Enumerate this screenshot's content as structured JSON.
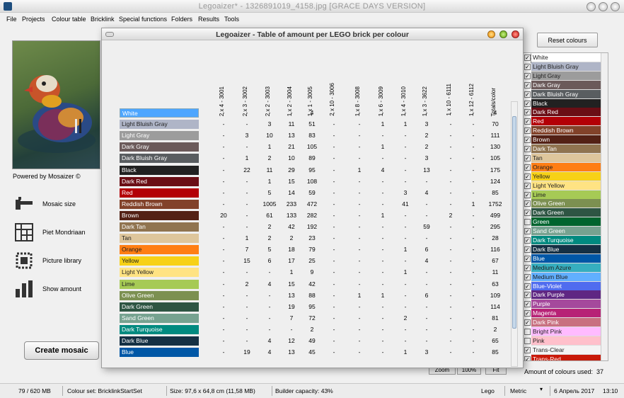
{
  "window": {
    "title": "Legoaizer* - 1326891019_4158.jpg      [GRACE DAYS VERSION]"
  },
  "menu": [
    "File",
    "Projects",
    "Colour table",
    "Bricklink",
    "Special functions",
    "Folders",
    "Results",
    "Tools"
  ],
  "left_panel": {
    "powered": "Powered by Mosaizer ©",
    "tools": [
      "Mosaic size",
      "Piet Mondriaan",
      "Picture library",
      "Show amount"
    ],
    "create_button": "Create mosaic"
  },
  "right_panel": {
    "reset_button": "Reset colours",
    "colours_used_label": "Amount of colours used:",
    "colours_used_value": "37",
    "colours": [
      {
        "name": "White",
        "hex": "#ffffff",
        "checked": true,
        "selected": true
      },
      {
        "name": "Light Bluish Gray",
        "hex": "#afb5c7",
        "checked": true
      },
      {
        "name": "Light Gray",
        "hex": "#9c9c9c",
        "checked": true
      },
      {
        "name": "Dark Gray",
        "hex": "#6b5a5a",
        "checked": true
      },
      {
        "name": "Dark Bluish Gray",
        "hex": "#595d60",
        "checked": true
      },
      {
        "name": "Black",
        "hex": "#212121",
        "checked": true
      },
      {
        "name": "Dark Red",
        "hex": "#6a0e15",
        "checked": true
      },
      {
        "name": "Red",
        "hex": "#b30006",
        "checked": true
      },
      {
        "name": "Reddish Brown",
        "hex": "#82422a",
        "checked": true
      },
      {
        "name": "Brown",
        "hex": "#532115",
        "checked": true
      },
      {
        "name": "Dark Tan",
        "hex": "#907450",
        "checked": true
      },
      {
        "name": "Tan",
        "hex": "#dec69c",
        "checked": true
      },
      {
        "name": "Orange",
        "hex": "#ff7e14",
        "checked": true
      },
      {
        "name": "Yellow",
        "hex": "#f7d117",
        "checked": true
      },
      {
        "name": "Light Yellow",
        "hex": "#ffe383",
        "checked": true
      },
      {
        "name": "Lime",
        "hex": "#a6ca55",
        "checked": true
      },
      {
        "name": "Olive Green",
        "hex": "#7c9051",
        "checked": true
      },
      {
        "name": "Dark Green",
        "hex": "#2e5543",
        "checked": true
      },
      {
        "name": "Green",
        "hex": "#00642e",
        "checked": false
      },
      {
        "name": "Sand Green",
        "hex": "#76a290",
        "checked": true
      },
      {
        "name": "Dark Turquoise",
        "hex": "#008a80",
        "checked": true
      },
      {
        "name": "Dark Blue",
        "hex": "#143044",
        "checked": true
      },
      {
        "name": "Blue",
        "hex": "#0057a6",
        "checked": true
      },
      {
        "name": "Medium Azure",
        "hex": "#36aebf",
        "checked": true
      },
      {
        "name": "Medium Blue",
        "hex": "#61afff",
        "checked": true
      },
      {
        "name": "Blue-Violet",
        "hex": "#506cef",
        "checked": true
      },
      {
        "name": "Dark Purple",
        "hex": "#5f2683",
        "checked": true
      },
      {
        "name": "Purple",
        "hex": "#a5499c",
        "checked": true
      },
      {
        "name": "Magenta",
        "hex": "#b72276",
        "checked": true
      },
      {
        "name": "Dark Pink",
        "hex": "#c87080",
        "checked": true
      },
      {
        "name": "Bright Pink",
        "hex": "#ffbbff",
        "checked": false
      },
      {
        "name": "Pink",
        "hex": "#ffc0cb",
        "checked": false
      },
      {
        "name": "Trans-Clear",
        "hex": "#f4f4f4",
        "checked": true
      },
      {
        "name": "Trans-Red",
        "hex": "#c91a09",
        "checked": true
      }
    ]
  },
  "zoom": {
    "label": "Zoom",
    "value": "100%",
    "fit": "Fit"
  },
  "status": {
    "memory": "79 / 620 MB",
    "colour_set": "Colour set: BricklinkStartSet",
    "size": "Size: 97,6 x 64,8 cm (11,58 MB)",
    "capacity": "Builder capacity: 43%",
    "brand": "Lego",
    "unit": "Metric",
    "date": "6 Апрель 2017",
    "time": "13:10"
  },
  "dialog": {
    "title": "Legoaizer - Table of amount per LEGO brick per colour",
    "headers": [
      "2 x 4 - 3001",
      "2 x 3 - 3002",
      "2 x 2 - 3003",
      "1 x 2 - 3004",
      "1 x 1 - 3005",
      "2 x 10 - 3006",
      "1 x 8 - 3008",
      "1 x 6 - 3009",
      "1 x 4 - 3010",
      "1 x 3 - 3622",
      "1 x 10 - 6111",
      "1 x 12 - 6112",
      "Totals/color"
    ],
    "rows": [
      {
        "name": "White",
        "hex": "#4da6ff",
        "text": "#ffffff",
        "cells": [
          "-",
          "-",
          "-",
          "-",
          "4",
          "-",
          "-",
          "-",
          "-",
          "-",
          "-",
          "-",
          "4"
        ]
      },
      {
        "name": "Light Bluish Gray",
        "hex": "#afb5c7",
        "text": "#222222",
        "cells": [
          "-",
          "-",
          "3",
          "11",
          "51",
          "-",
          "-",
          "1",
          "1",
          "3",
          "-",
          "-",
          "70"
        ]
      },
      {
        "name": "Light Gray",
        "hex": "#9c9c9c",
        "text": "#ffffff",
        "cells": [
          "-",
          "3",
          "10",
          "13",
          "83",
          "-",
          "-",
          "-",
          "-",
          "2",
          "-",
          "-",
          "111"
        ]
      },
      {
        "name": "Dark Gray",
        "hex": "#6b5a5a",
        "text": "#ffffff",
        "cells": [
          "-",
          "-",
          "1",
          "21",
          "105",
          "-",
          "-",
          "1",
          "-",
          "2",
          "-",
          "-",
          "130"
        ]
      },
      {
        "name": "Dark Bluish Gray",
        "hex": "#595d60",
        "text": "#ffffff",
        "cells": [
          "-",
          "1",
          "2",
          "10",
          "89",
          "-",
          "-",
          "-",
          "-",
          "3",
          "-",
          "-",
          "105"
        ]
      },
      {
        "name": "Black",
        "hex": "#212121",
        "text": "#ffffff",
        "cells": [
          "-",
          "22",
          "11",
          "29",
          "95",
          "-",
          "1",
          "4",
          "-",
          "13",
          "-",
          "-",
          "175"
        ]
      },
      {
        "name": "Dark Red",
        "hex": "#6a0e15",
        "text": "#ffffff",
        "cells": [
          "-",
          "-",
          "1",
          "15",
          "108",
          "-",
          "-",
          "-",
          "-",
          "-",
          "-",
          "-",
          "124"
        ]
      },
      {
        "name": "Red",
        "hex": "#b30006",
        "text": "#ffffff",
        "cells": [
          "-",
          "-",
          "5",
          "14",
          "59",
          "-",
          "-",
          "-",
          "3",
          "4",
          "-",
          "-",
          "85"
        ]
      },
      {
        "name": "Reddish Brown",
        "hex": "#82422a",
        "text": "#ffffff",
        "cells": [
          "-",
          "-",
          "1005",
          "233",
          "472",
          "-",
          "-",
          "-",
          "41",
          "-",
          "-",
          "1",
          "1752"
        ]
      },
      {
        "name": "Brown",
        "hex": "#532115",
        "text": "#ffffff",
        "cells": [
          "20",
          "-",
          "61",
          "133",
          "282",
          "-",
          "-",
          "1",
          "-",
          "-",
          "2",
          "-",
          "499"
        ]
      },
      {
        "name": "Dark Tan",
        "hex": "#907450",
        "text": "#ffffff",
        "cells": [
          "-",
          "-",
          "2",
          "42",
          "192",
          "-",
          "-",
          "-",
          "-",
          "59",
          "-",
          "-",
          "295"
        ]
      },
      {
        "name": "Tan",
        "hex": "#dec69c",
        "text": "#222222",
        "cells": [
          "-",
          "1",
          "2",
          "2",
          "23",
          "-",
          "-",
          "-",
          "-",
          "-",
          "-",
          "-",
          "28"
        ]
      },
      {
        "name": "Orange",
        "hex": "#ff7e14",
        "text": "#222222",
        "cells": [
          "-",
          "7",
          "5",
          "18",
          "79",
          "-",
          "-",
          "-",
          "1",
          "6",
          "-",
          "-",
          "116"
        ]
      },
      {
        "name": "Yellow",
        "hex": "#f7d117",
        "text": "#222222",
        "cells": [
          "-",
          "15",
          "6",
          "17",
          "25",
          "-",
          "-",
          "-",
          "-",
          "4",
          "-",
          "-",
          "67"
        ]
      },
      {
        "name": "Light Yellow",
        "hex": "#ffe383",
        "text": "#222222",
        "cells": [
          "-",
          "-",
          "-",
          "1",
          "9",
          "-",
          "-",
          "-",
          "1",
          "-",
          "-",
          "-",
          "11"
        ]
      },
      {
        "name": "Lime",
        "hex": "#a6ca55",
        "text": "#222222",
        "cells": [
          "-",
          "2",
          "4",
          "15",
          "42",
          "-",
          "-",
          "-",
          "-",
          "-",
          "-",
          "-",
          "63"
        ]
      },
      {
        "name": "Olive Green",
        "hex": "#7c9051",
        "text": "#ffffff",
        "cells": [
          "-",
          "-",
          "-",
          "13",
          "88",
          "-",
          "1",
          "1",
          "-",
          "6",
          "-",
          "-",
          "109"
        ]
      },
      {
        "name": "Dark Green",
        "hex": "#2e5543",
        "text": "#ffffff",
        "cells": [
          "-",
          "-",
          "-",
          "19",
          "95",
          "-",
          "-",
          "-",
          "-",
          "-",
          "-",
          "-",
          "114"
        ]
      },
      {
        "name": "Sand Green",
        "hex": "#76a290",
        "text": "#ffffff",
        "cells": [
          "-",
          "-",
          "-",
          "7",
          "72",
          "-",
          "-",
          "-",
          "2",
          "-",
          "-",
          "-",
          "81"
        ]
      },
      {
        "name": "Dark Turquoise",
        "hex": "#008a80",
        "text": "#ffffff",
        "cells": [
          "-",
          "-",
          "-",
          "-",
          "2",
          "-",
          "-",
          "-",
          "-",
          "-",
          "-",
          "-",
          "2"
        ]
      },
      {
        "name": "Dark Blue",
        "hex": "#143044",
        "text": "#ffffff",
        "cells": [
          "-",
          "-",
          "4",
          "12",
          "49",
          "-",
          "-",
          "-",
          "-",
          "-",
          "-",
          "-",
          "65"
        ]
      },
      {
        "name": "Blue",
        "hex": "#0057a6",
        "text": "#ffffff",
        "cells": [
          "-",
          "19",
          "4",
          "13",
          "45",
          "-",
          "-",
          "-",
          "1",
          "3",
          "-",
          "-",
          "85"
        ]
      }
    ]
  }
}
